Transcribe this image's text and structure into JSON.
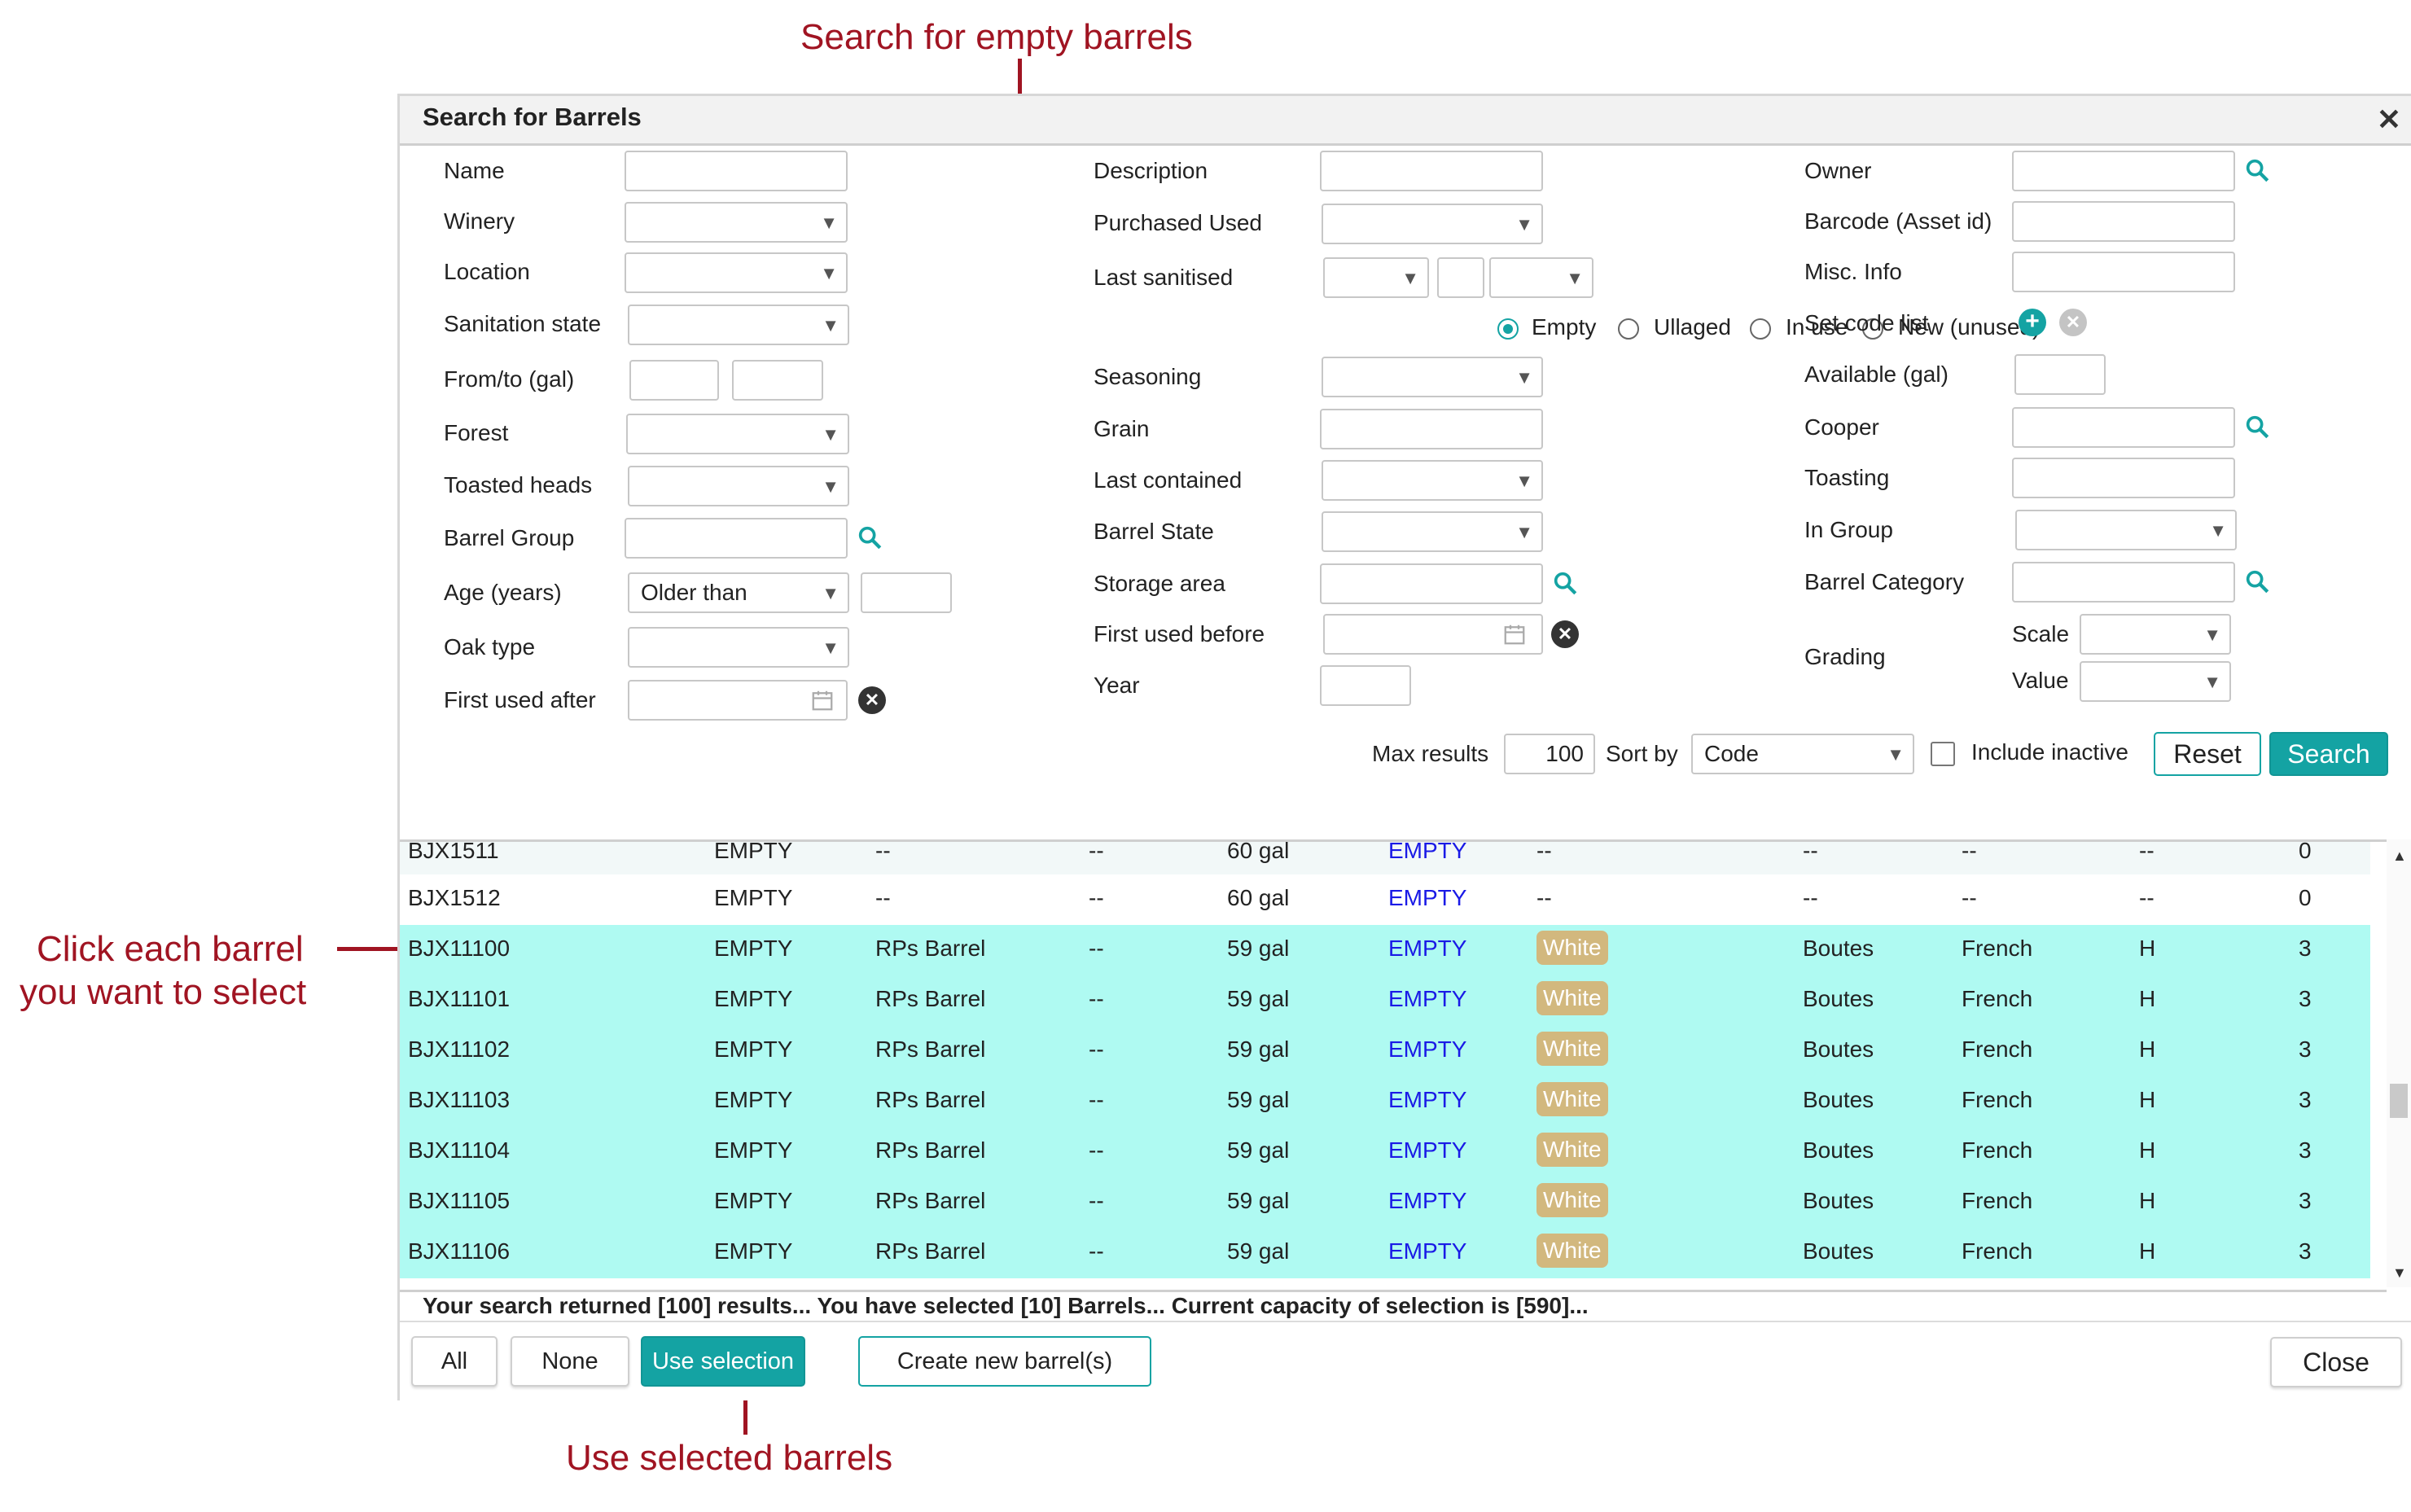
{
  "annotations": {
    "search_empty": "Search for empty barrels",
    "click_each_line1": "Click each barrel",
    "click_each_line2": "you want to select",
    "use_selected": "Use selected barrels"
  },
  "dialog": {
    "title": "Search for Barrels",
    "close_icon": "close-icon"
  },
  "form": {
    "col1": {
      "name": "Name",
      "winery": "Winery",
      "location": "Location",
      "sanitation_state": "Sanitation state",
      "from_to": "From/to (gal)",
      "forest": "Forest",
      "toasted_heads": "Toasted heads",
      "barrel_group": "Barrel Group",
      "age": "Age (years)",
      "age_value": "Older than",
      "oak_type": "Oak type",
      "first_used_after": "First used after"
    },
    "col2": {
      "description": "Description",
      "purchased_used": "Purchased Used",
      "last_sanitised": "Last sanitised",
      "radios": [
        "Empty",
        "Ullaged",
        "In use",
        "New (unused)"
      ],
      "radio_selected": "Empty",
      "seasoning": "Seasoning",
      "grain": "Grain",
      "last_contained": "Last contained",
      "barrel_state": "Barrel State",
      "storage_area": "Storage area",
      "first_used_before": "First used before",
      "year": "Year"
    },
    "col3": {
      "owner": "Owner",
      "barcode": "Barcode (Asset id)",
      "misc_info": "Misc. Info",
      "set_code_list": "Set code list",
      "available": "Available (gal)",
      "cooper": "Cooper",
      "toasting": "Toasting",
      "in_group": "In Group",
      "barrel_category": "Barrel Category",
      "grading": "Grading",
      "scale": "Scale",
      "value": "Value"
    },
    "bottom": {
      "max_results_label": "Max results",
      "max_results_value": "100",
      "sort_by_label": "Sort by",
      "sort_by_value": "Code",
      "include_inactive": "Include inactive",
      "reset": "Reset",
      "search": "Search"
    }
  },
  "results": {
    "rows": [
      {
        "code": "BJX1511",
        "state": "EMPTY",
        "desc": "--",
        "c4": "--",
        "cap": "60 gal",
        "status": "EMPTY",
        "color": "--",
        "cooper": "--",
        "forest": "--",
        "toast": "--",
        "age": "0",
        "selected": false
      },
      {
        "code": "BJX1512",
        "state": "EMPTY",
        "desc": "--",
        "c4": "--",
        "cap": "60 gal",
        "status": "EMPTY",
        "color": "--",
        "cooper": "--",
        "forest": "--",
        "toast": "--",
        "age": "0",
        "selected": false
      },
      {
        "code": "BJX11100",
        "state": "EMPTY",
        "desc": "RPs Barrel",
        "c4": "--",
        "cap": "59 gal",
        "status": "EMPTY",
        "color": "White",
        "cooper": "Boutes",
        "forest": "French",
        "toast": "H",
        "age": "3",
        "selected": true
      },
      {
        "code": "BJX11101",
        "state": "EMPTY",
        "desc": "RPs Barrel",
        "c4": "--",
        "cap": "59 gal",
        "status": "EMPTY",
        "color": "White",
        "cooper": "Boutes",
        "forest": "French",
        "toast": "H",
        "age": "3",
        "selected": true
      },
      {
        "code": "BJX11102",
        "state": "EMPTY",
        "desc": "RPs Barrel",
        "c4": "--",
        "cap": "59 gal",
        "status": "EMPTY",
        "color": "White",
        "cooper": "Boutes",
        "forest": "French",
        "toast": "H",
        "age": "3",
        "selected": true
      },
      {
        "code": "BJX11103",
        "state": "EMPTY",
        "desc": "RPs Barrel",
        "c4": "--",
        "cap": "59 gal",
        "status": "EMPTY",
        "color": "White",
        "cooper": "Boutes",
        "forest": "French",
        "toast": "H",
        "age": "3",
        "selected": true
      },
      {
        "code": "BJX11104",
        "state": "EMPTY",
        "desc": "RPs Barrel",
        "c4": "--",
        "cap": "59 gal",
        "status": "EMPTY",
        "color": "White",
        "cooper": "Boutes",
        "forest": "French",
        "toast": "H",
        "age": "3",
        "selected": true
      },
      {
        "code": "BJX11105",
        "state": "EMPTY",
        "desc": "RPs Barrel",
        "c4": "--",
        "cap": "59 gal",
        "status": "EMPTY",
        "color": "White",
        "cooper": "Boutes",
        "forest": "French",
        "toast": "H",
        "age": "3",
        "selected": true
      },
      {
        "code": "BJX11106",
        "state": "EMPTY",
        "desc": "RPs Barrel",
        "c4": "--",
        "cap": "59 gal",
        "status": "EMPTY",
        "color": "White",
        "cooper": "Boutes",
        "forest": "French",
        "toast": "H",
        "age": "3",
        "selected": true
      }
    ],
    "status_text": "Your search returned [100] results... You have selected [10] Barrels... Current capacity of selection is [590]..."
  },
  "footer": {
    "all": "All",
    "none": "None",
    "use_selection": "Use selection",
    "create_new": "Create new barrel(s)",
    "close": "Close"
  },
  "colors": {
    "accent": "#14a3a3",
    "selected_row": "#affaf2",
    "annotation": "#a01422",
    "status_link": "#1a1ae6",
    "white_pill": "#d2b87e"
  }
}
